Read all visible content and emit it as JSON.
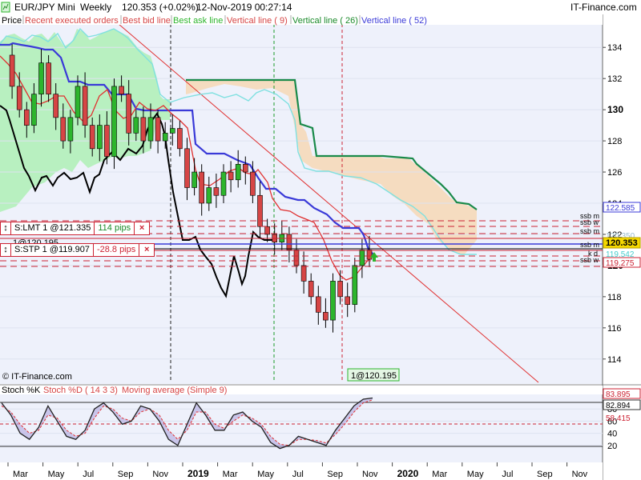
{
  "header": {
    "symbol": "EUR/JPY Mini",
    "timeframe": "Weekly",
    "price_change": "120.353 (+0.02%)",
    "datetime": "12-Nov-2019 00:27:14",
    "brand": "IT-Finance.com"
  },
  "legend": {
    "price": "Price",
    "recent": "Recent executed orders",
    "bid": "Best bid line",
    "ask": "Best ask line",
    "vline9": "Vertical line ( 9)",
    "vline26": "Vertical line ( 26)",
    "vline52": "Vertical line ( 52)",
    "copyright": "© IT-Finance.com"
  },
  "orders": {
    "limit": {
      "label": "S:LMT 1 @121.335",
      "pips": "114 pips",
      "close": "×"
    },
    "stop": {
      "label": "S:STP 1 @119.907",
      "pips": "-28.8 pips",
      "close": "×"
    },
    "position": "1@120.195",
    "position_bottom": "1@120.195"
  },
  "right_labels": {
    "ssb_m": "ssb m",
    "ssb_w": "ssb w",
    "ks_d": "k d",
    "last_blue": "122.585",
    "last_price": "120.353",
    "value_teal": "119.542",
    "value_red": "119.275",
    "value_hidden": "120.350"
  },
  "stoch": {
    "title": "Stoch %K",
    "d_label": "Stoch %D ( 14 3 3)",
    "ma_label": "Moving average (Simple 9)",
    "value1": "83.895",
    "value2": "82.894",
    "value3": "58.415"
  },
  "colors": {
    "bull_candle": "#2db52d",
    "bear_candle": "#d64545",
    "kijun": "#3a3ad8",
    "tenkan": "#e03030",
    "chikou": "#000000",
    "cloud_green": "#b8f0c0",
    "cloud_orange": "#f5dcc0",
    "ssb_green": "#1a8a4a",
    "ssa_teal": "#7fe0e0"
  },
  "chart_data": [
    {
      "type": "line",
      "title": "EUR/JPY Mini Weekly",
      "y_ticks": [
        "134",
        "132",
        "130",
        "128",
        "126",
        "124",
        "122",
        "120",
        "118",
        "116",
        "114"
      ],
      "x_ticks": [
        "Mar",
        "May",
        "Jul",
        "Sep",
        "Nov",
        "2019",
        "Mar",
        "May",
        "Jul",
        "Sep",
        "Nov",
        "2020",
        "Mar",
        "May",
        "Jul",
        "Sep",
        "Nov"
      ],
      "ylim": [
        112.5,
        135.5
      ],
      "series": [
        {
          "name": "Price",
          "values": [
            133.5,
            131.5,
            130.0,
            129.0,
            131.0,
            133.0,
            131.0,
            129.5,
            128.0,
            129.5,
            131.5,
            129.0,
            127.5,
            129.0,
            127.0,
            131.5,
            131.0,
            128.5,
            129.5,
            128.0,
            129.5,
            128.0,
            128.5,
            128.8,
            127.5,
            125.0,
            126.0,
            124.0,
            125.0,
            124.5,
            126.0,
            125.5,
            126.5,
            126.0,
            124.5,
            122.5,
            122.0,
            121.5,
            122.0,
            121.0,
            120.0,
            119.0,
            118.0,
            117.0,
            116.5,
            119.0,
            118.0,
            117.5,
            120.0,
            121.0,
            120.4
          ]
        },
        {
          "name": "Kijun",
          "values": [
            129.5,
            129.5,
            129.5,
            131.0,
            131.0,
            131.0,
            131.0,
            131.0,
            130.0,
            130.0,
            130.0,
            129.0,
            129.0,
            129.0,
            129.0,
            129.0,
            128.5,
            128.0,
            126.0,
            125.5,
            125.5,
            125.5,
            125.0,
            124.0,
            123.5,
            123.0,
            122.0,
            121.5,
            121.0,
            120.5,
            120.4,
            120.3
          ]
        },
        {
          "name": "Senkou Span B",
          "values": [
            130.3,
            130.3,
            130.3,
            130.3,
            130.3,
            128.5,
            127.0,
            126.0,
            126.0,
            126.0,
            126.0,
            126.0,
            125.0,
            124.0,
            123.0,
            122.9,
            122.6
          ]
        }
      ]
    },
    {
      "type": "line",
      "title": "Stoch %K",
      "y_ticks": [
        "80",
        "60",
        "40",
        "20"
      ],
      "ylim": [
        0,
        100
      ],
      "series": [
        {
          "name": "Stoch %K",
          "values": [
            90,
            70,
            40,
            30,
            50,
            85,
            60,
            35,
            30,
            45,
            80,
            90,
            75,
            55,
            60,
            85,
            80,
            60,
            30,
            20,
            55,
            90,
            70,
            45,
            45,
            70,
            75,
            60,
            50,
            25,
            15,
            20,
            35,
            30,
            25,
            20,
            45,
            65,
            85,
            96,
            98
          ]
        },
        {
          "name": "Stoch %D",
          "values": [
            85,
            75,
            55,
            40,
            45,
            70,
            65,
            45,
            35,
            40,
            65,
            85,
            80,
            65,
            60,
            75,
            80,
            70,
            45,
            30,
            45,
            75,
            75,
            55,
            48,
            60,
            70,
            65,
            55,
            35,
            22,
            20,
            30,
            30,
            28,
            24,
            38,
            55,
            75,
            90,
            95
          ]
        }
      ]
    }
  ]
}
